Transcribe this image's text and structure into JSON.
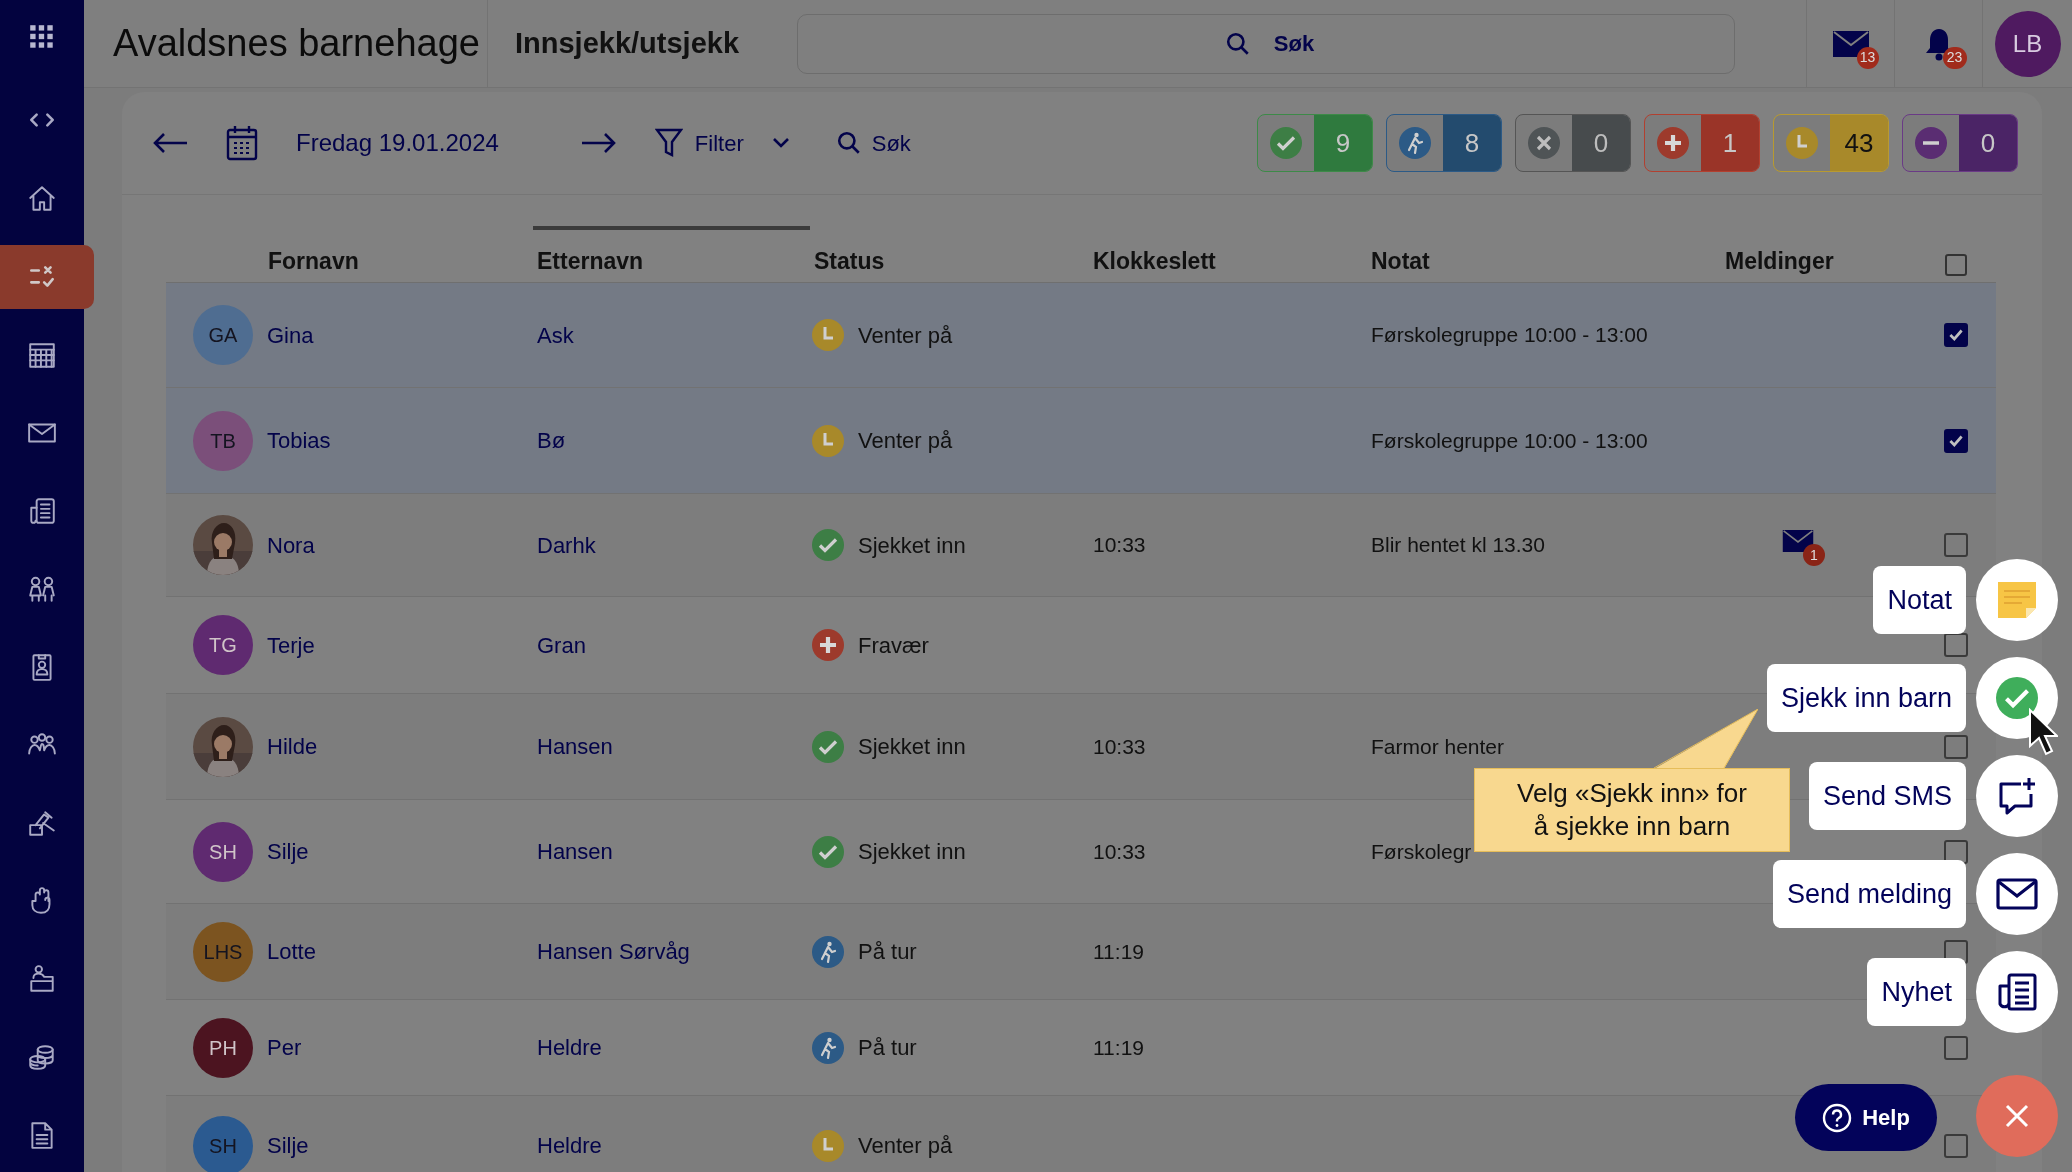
{
  "app_title": "Avaldsnes barnehage",
  "page_title": "Innsjekk/utsjekk",
  "search": {
    "placeholder": "Søk"
  },
  "header": {
    "messages_badge": "13",
    "notifications_badge": "23",
    "user_initials": "LB"
  },
  "sidebar": {
    "items": [
      {
        "selected": false
      },
      {
        "selected": false
      },
      {
        "selected": true
      },
      {
        "selected": false
      },
      {
        "selected": false
      },
      {
        "selected": false
      },
      {
        "selected": false
      },
      {
        "selected": false
      },
      {
        "selected": false
      },
      {
        "selected": false
      },
      {
        "selected": false
      },
      {
        "selected": false
      },
      {
        "selected": false
      },
      {
        "selected": false
      }
    ]
  },
  "toolbar": {
    "date": "Fredag 19.01.2024",
    "filter": "Filter",
    "search": "Søk"
  },
  "counters": [
    {
      "kind": "checked_in",
      "count": "9"
    },
    {
      "kind": "trip",
      "count": "8"
    },
    {
      "kind": "cancelled",
      "count": "0"
    },
    {
      "kind": "absent",
      "count": "1"
    },
    {
      "kind": "waiting",
      "count": "43"
    },
    {
      "kind": "off",
      "count": "0"
    }
  ],
  "table": {
    "columns": [
      {
        "label": "Fornavn",
        "sorted": false
      },
      {
        "label": "Etternavn",
        "sorted": true
      },
      {
        "label": "Status",
        "sorted": false
      },
      {
        "label": "Klokkeslett",
        "sorted": false
      },
      {
        "label": "Notat",
        "sorted": false
      },
      {
        "label": "Meldinger",
        "sorted": false
      }
    ],
    "select_all": {
      "checked": false
    },
    "rows": [
      {
        "avatar": {
          "kind": "initials",
          "initials": "GA",
          "color": "#4f6d91"
        },
        "first_name": "Gina",
        "last_name": "Ask",
        "status": {
          "kind": "waiting",
          "label": "Venter på"
        },
        "note": "Førskolegruppe 10:00 - 13:00",
        "selected": true
      },
      {
        "avatar": {
          "kind": "initials",
          "initials": "TB",
          "color": "#7b4f7a"
        },
        "first_name": "Tobias",
        "last_name": "Bø",
        "status": {
          "kind": "waiting",
          "label": "Venter på"
        },
        "note": "Førskolegruppe 10:00 - 13:00",
        "selected": true
      },
      {
        "first_name": "Nora",
        "last_name": "Darhk",
        "status": {
          "kind": "checked_in",
          "label": "Sjekket inn"
        },
        "time": "10:33",
        "note": "Blir hentet kl 13.30",
        "messages": "1",
        "selected": false
      },
      {
        "avatar": {
          "kind": "initials",
          "initials": "TG",
          "color": "#5f2a70"
        },
        "first_name": "Terje",
        "last_name": "Gran",
        "status": {
          "kind": "absent",
          "label": "Fravær"
        },
        "selected": false
      },
      {
        "first_name": "Hilde",
        "last_name": "Hansen",
        "status": {
          "kind": "checked_in",
          "label": "Sjekket inn"
        },
        "time": "10:33",
        "note": "Farmor henter",
        "selected": false
      },
      {
        "avatar": {
          "kind": "initials",
          "initials": "SH",
          "color": "#5f2a70"
        },
        "first_name": "Silje",
        "last_name": "Hansen",
        "status": {
          "kind": "checked_in",
          "label": "Sjekket inn"
        },
        "time": "10:33",
        "note": "Førskolegr",
        "selected": false
      },
      {
        "avatar": {
          "kind": "initials",
          "initials": "LHS",
          "color": "#7c5420"
        },
        "first_name": "Lotte",
        "last_name": "Hansen Sørvåg",
        "status": {
          "kind": "trip",
          "label": "På tur"
        },
        "time": "11:19",
        "selected": false
      },
      {
        "avatar": {
          "kind": "initials",
          "initials": "PH",
          "color": "#4c1420"
        },
        "first_name": "Per",
        "last_name": "Heldre",
        "status": {
          "kind": "trip",
          "label": "På tur"
        },
        "time": "11:19",
        "selected": false
      },
      {
        "avatar": {
          "kind": "initials",
          "initials": "SH",
          "color": "#2b5a90"
        },
        "first_name": "Silje",
        "last_name": "Heldre",
        "status": {
          "kind": "waiting",
          "label": "Venter på"
        },
        "selected": false
      }
    ]
  },
  "actions": [
    {
      "kind": "note",
      "label": "Notat"
    },
    {
      "kind": "check_in",
      "label": "Sjekk inn barn"
    },
    {
      "kind": "sms",
      "label": "Send SMS"
    },
    {
      "kind": "message",
      "label": "Send melding"
    },
    {
      "kind": "news",
      "label": "Nyhet"
    }
  ],
  "tooltip": "Velg «Sjekk inn» for å sjekke inn barn",
  "help_button": "Help"
}
